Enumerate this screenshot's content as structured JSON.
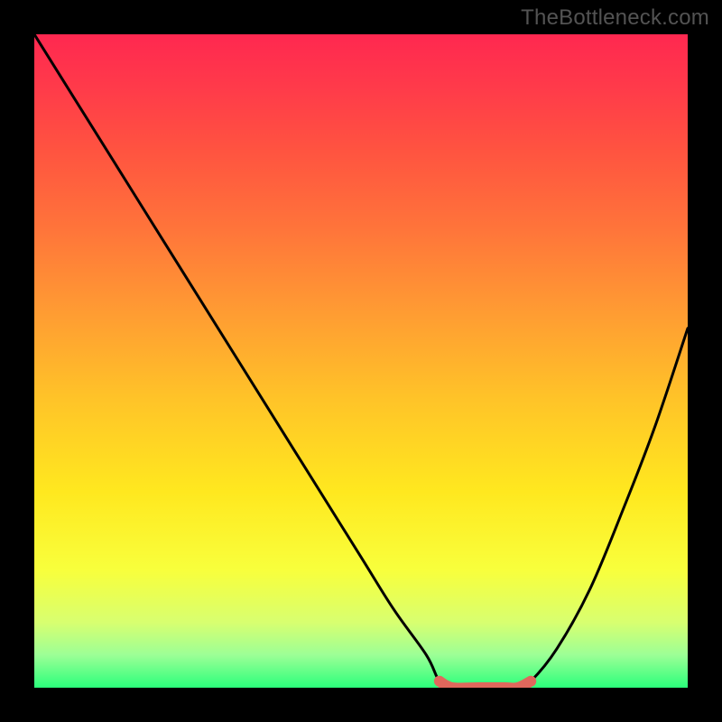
{
  "watermark": "TheBottleneck.com",
  "chart_data": {
    "type": "line",
    "title": "",
    "xlabel": "",
    "ylabel": "",
    "xlim": [
      0,
      100
    ],
    "ylim": [
      0,
      100
    ],
    "series": [
      {
        "name": "curve",
        "x": [
          0,
          10,
          20,
          30,
          40,
          50,
          55,
          60,
          62,
          64,
          68,
          72,
          74,
          76,
          80,
          85,
          90,
          95,
          100
        ],
        "values": [
          100,
          84,
          68,
          52,
          36,
          20,
          12,
          5,
          1,
          0,
          0,
          0,
          0,
          1,
          6,
          15,
          27,
          40,
          55
        ]
      },
      {
        "name": "optimal-segment",
        "x": [
          62,
          64,
          68,
          72,
          74,
          76
        ],
        "values": [
          1,
          0,
          0,
          0,
          0,
          1
        ]
      }
    ],
    "annotations": [],
    "colors": {
      "curve": "#000000",
      "optimal": "#e0675c",
      "gradient_top": "#ff2850",
      "gradient_bottom": "#2bff7b"
    }
  }
}
